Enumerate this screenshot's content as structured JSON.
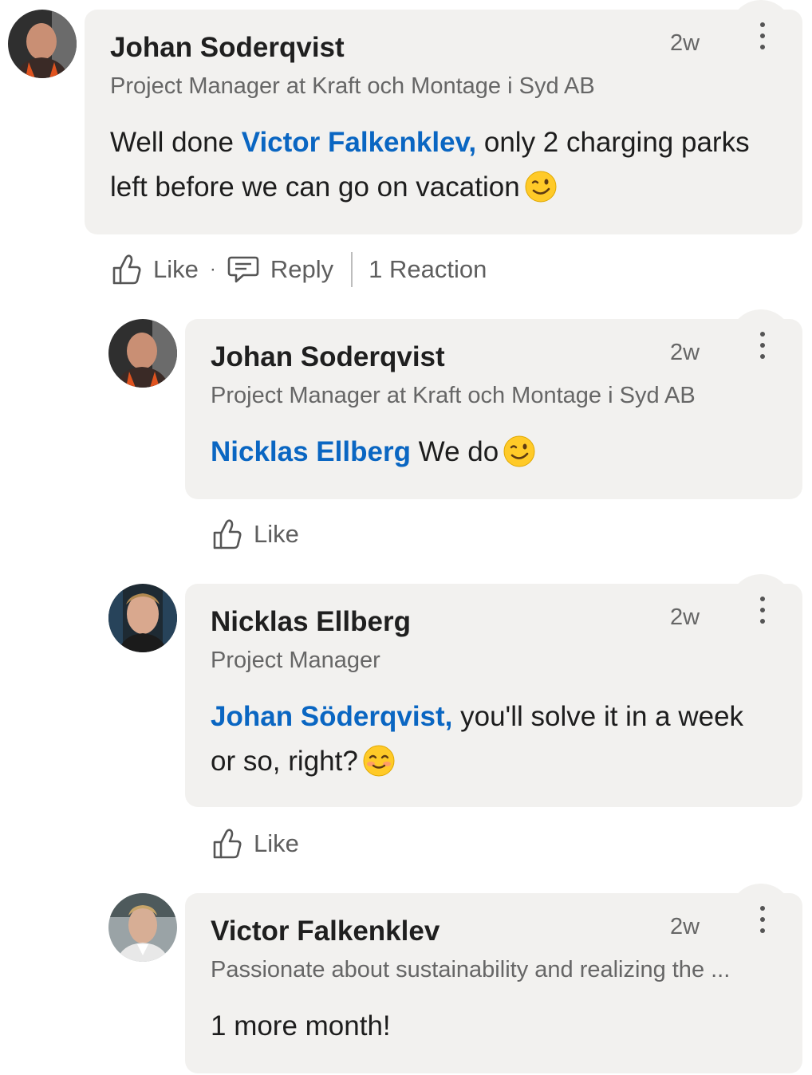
{
  "comments": [
    {
      "author": "Johan Soderqvist",
      "headline": "Project Manager at Kraft och Montage i Syd AB",
      "time": "2w",
      "text_prefix": "Well done ",
      "mention": "Victor Falkenklev,",
      "text_line1_rest": " only 2 charging parks",
      "text_line2": "left before we can go on vacation",
      "emoji": "wink-emoji",
      "actions": {
        "like": "Like",
        "separator": "·",
        "reply": "Reply",
        "reactions": "1 Reaction"
      }
    },
    {
      "author": "Johan Soderqvist",
      "headline": "Project Manager at Kraft och Montage i Syd AB",
      "time": "2w",
      "mention": "Nicklas Ellberg",
      "text_rest": " We do",
      "emoji": "wink-emoji",
      "actions": {
        "like": "Like"
      }
    },
    {
      "author": "Nicklas Ellberg",
      "headline": "Project Manager",
      "time": "2w",
      "mention": "Johan Söderqvist,",
      "text_line1_rest": " you'll solve it in a week",
      "text_line2": "or so, right?",
      "emoji": "smiling-emoji",
      "actions": {
        "like": "Like"
      }
    },
    {
      "author": "Victor Falkenklev",
      "headline": "Passionate about sustainability and realizing the ...",
      "time": "2w",
      "text": "1 more month!"
    }
  ],
  "colors": {
    "mention": "#0a66c2",
    "bubble": "#f2f1ef",
    "secondary_text": "#666666"
  }
}
